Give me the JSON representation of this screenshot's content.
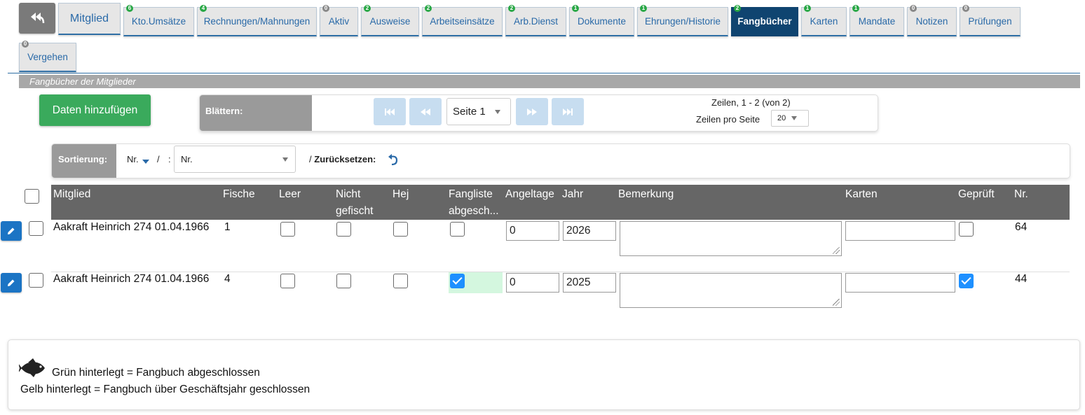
{
  "tabs": [
    {
      "label": "Mitglied",
      "badge": ""
    },
    {
      "label": "Kto.Umsätze",
      "badge": "6"
    },
    {
      "label": "Rechnungen/Mahnungen",
      "badge": "4"
    },
    {
      "label": "Aktiv",
      "badge": "0"
    },
    {
      "label": "Ausweise",
      "badge": "2"
    },
    {
      "label": "Arbeitseinsätze",
      "badge": "2"
    },
    {
      "label": "Arb.Dienst",
      "badge": "2"
    },
    {
      "label": "Dokumente",
      "badge": "1"
    },
    {
      "label": "Ehrungen/Historie",
      "badge": "1"
    },
    {
      "label": "Fangbücher",
      "badge": "2"
    },
    {
      "label": "Karten",
      "badge": "1"
    },
    {
      "label": "Mandate",
      "badge": "1"
    },
    {
      "label": "Notizen",
      "badge": "0"
    },
    {
      "label": "Prüfungen",
      "badge": "0"
    },
    {
      "label": "Vergehen",
      "badge": "0"
    }
  ],
  "section_title": "Fangbücher der Mitglieder",
  "add_button": "Daten hinzufügen",
  "pager": {
    "label": "Blättern:",
    "page_value": "Seite 1",
    "rows_info": "Zeilen, 1 - 2 (von 2)",
    "rows_per_page_label": "Zeilen pro Seite",
    "rows_per_page_value": "20"
  },
  "sort": {
    "label": "Sortierung:",
    "field": "Nr.",
    "sep1": "/",
    "sep2": ":",
    "select_value": "Nr.",
    "reset_prefix": "/",
    "reset_label": "Zurücksetzen:"
  },
  "table": {
    "headers": {
      "mitglied": "Mitglied",
      "fische": "Fische",
      "leer": "Leer",
      "nicht_gefischt_1": "Nicht",
      "nicht_gefischt_2": "gefischt",
      "hej": "Hej",
      "fangliste_1": "Fangliste",
      "fangliste_2": "abgesch...",
      "angeltage": "Angeltage",
      "jahr": "Jahr",
      "bemerkung": "Bemerkung",
      "karten": "Karten",
      "geprueft": "Geprüft",
      "nr": "Nr."
    },
    "rows": [
      {
        "mitglied": "Aakraft Heinrich 274 01.04.1966",
        "fische": "1",
        "leer": false,
        "nicht_gefischt": false,
        "hej": false,
        "fangliste": false,
        "angeltage": "0",
        "jahr": "2026",
        "bemerkung": "",
        "karten": "",
        "geprueft": false,
        "nr": "64"
      },
      {
        "mitglied": "Aakraft Heinrich 274 01.04.1966",
        "fische": "4",
        "leer": false,
        "nicht_gefischt": false,
        "hej": false,
        "fangliste": true,
        "angeltage": "0",
        "jahr": "2025",
        "bemerkung": "",
        "karten": "",
        "geprueft": true,
        "nr": "44"
      }
    ]
  },
  "legend": {
    "line1": "Grün hinterlegt = Fangbuch abgeschlossen",
    "line2": "Gelb hinterlegt = Fangbuch über Geschäftsjahr geschlossen"
  },
  "colors": {
    "active_tab": "#0f4470",
    "add_button": "#3aaa5c",
    "table_header": "#666666",
    "checkbox_checked": "#1e90ff",
    "closed_highlight": "#d4f7df"
  }
}
